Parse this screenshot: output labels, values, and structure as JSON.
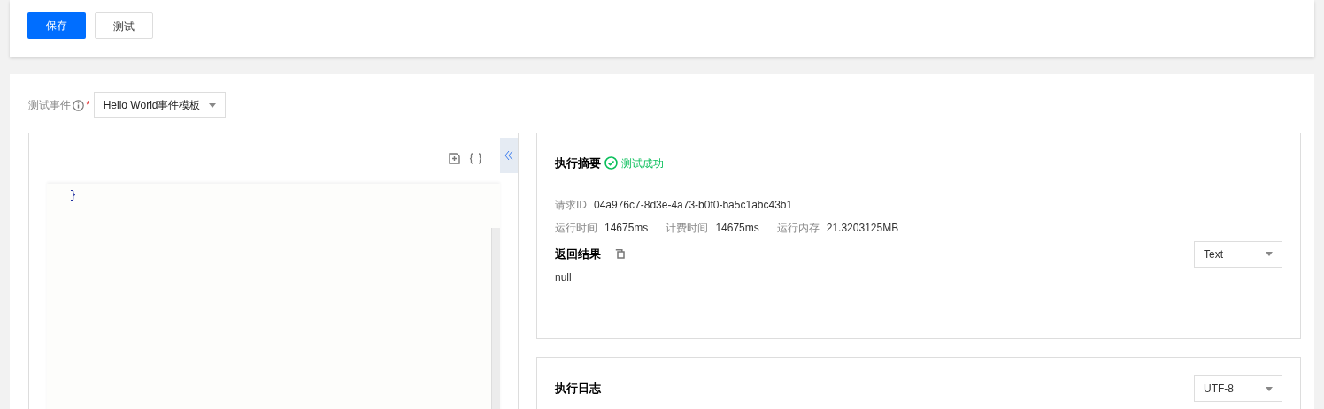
{
  "toolbar": {
    "buttons": [
      {
        "label": "保存",
        "kind": "primary"
      },
      {
        "label": "测试",
        "kind": "default"
      }
    ]
  },
  "test_event": {
    "label": "测试事件",
    "required_mark": "*",
    "value": "Hello World事件模板"
  },
  "editor": {
    "lines": [
      "}"
    ]
  },
  "summary": {
    "title": "执行摘要",
    "status": "测试成功",
    "fields": [
      [
        {
          "label": "请求ID",
          "value": "04a976c7-8d3e-4a73-b0f0-ba5c1abc43b1"
        }
      ],
      [
        {
          "label": "运行时间",
          "value": "14675ms"
        },
        {
          "label": "计费时间",
          "value": "14675ms"
        },
        {
          "label": "运行内存",
          "value": "21.3203125MB"
        }
      ]
    ],
    "result_title": "返回结果",
    "result_format": "Text",
    "result": "null"
  },
  "log": {
    "title": "执行日志",
    "encoding": "UTF-8"
  }
}
